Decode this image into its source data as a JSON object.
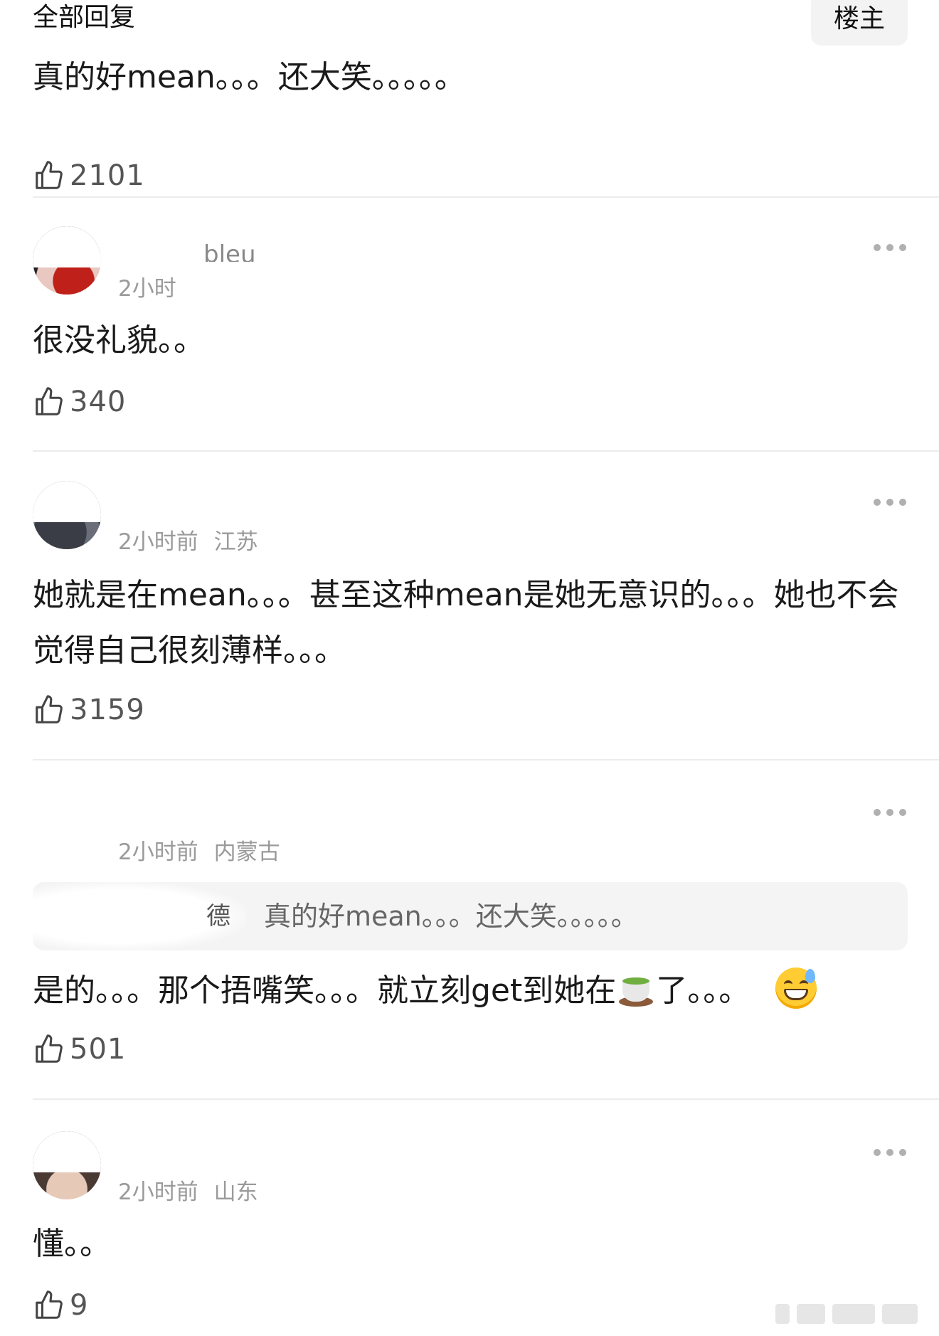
{
  "header": {
    "title": "全部回复",
    "op_badge": "楼主"
  },
  "comments": [
    {
      "text": "真的好mean。。。还大笑。。。。。",
      "likes": "2101"
    },
    {
      "username": "bleu",
      "meta_time": "2小时",
      "text": "很没礼貌。。",
      "likes": "340"
    },
    {
      "meta_time": "2小时前",
      "meta_location": "江苏",
      "text": "她就是在mean。。。甚至这种mean是她无意识的。。。她也不会觉得自己很刻薄样。。。",
      "likes": "3159"
    },
    {
      "meta_time": "2小时前",
      "meta_location": "内蒙古",
      "quote_author": "德",
      "quote_text": "真的好mean。。。还大笑。。。。。",
      "text_before": "是的。。。那个捂嘴笑。。。就立刻get到她在",
      "text_after": "了。。。",
      "likes": "501"
    },
    {
      "meta_time": "2小时前",
      "meta_location": "山东",
      "text": "懂。。",
      "likes": "9"
    }
  ],
  "icons": {
    "like": "thumbs-up-outline-icon",
    "more": "ellipsis-horizontal-icon",
    "tea": "teacup-emoji",
    "sweat_smile": "grinning-sweat-emoji"
  }
}
